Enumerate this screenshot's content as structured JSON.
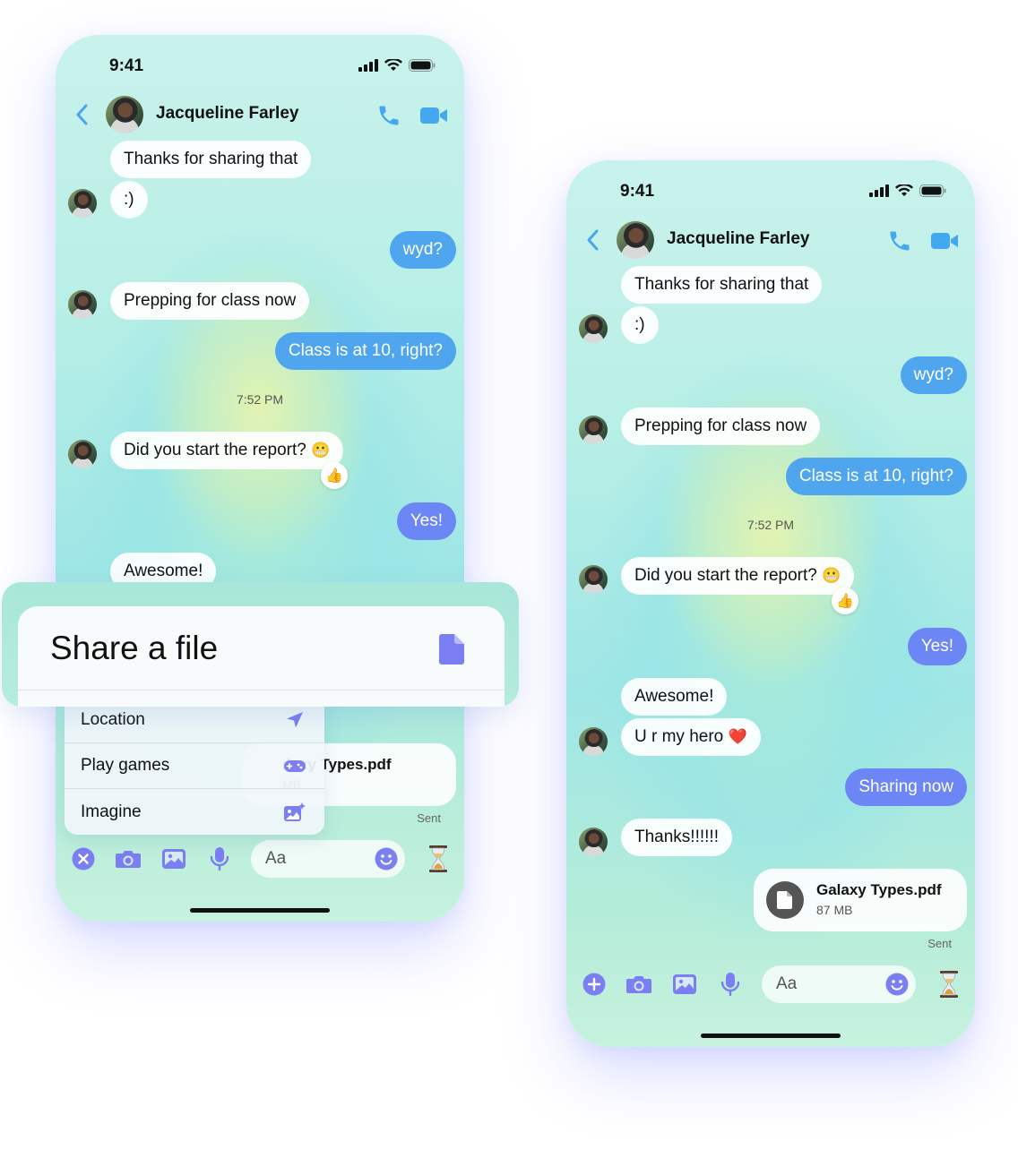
{
  "status": {
    "time": "9:41"
  },
  "contact": {
    "name": "Jacqueline Farley"
  },
  "messages": {
    "m1": "Thanks for sharing that",
    "m2": ":)",
    "m3": "wyd?",
    "m4": "Prepping for class now",
    "m5": "Class is at 10, right?",
    "timestamp": "7:52 PM",
    "m6": "Did you start the report?",
    "m6_emoji": "😬",
    "m6_reaction": "👍",
    "m7": "Yes!",
    "m8": "Awesome!",
    "m9": "U r my hero",
    "m9_emoji": "❤️",
    "m10": "Sharing now",
    "m11": "Thanks!!!!!!"
  },
  "file": {
    "name": "Galaxy Types.pdf",
    "size": "87 MB",
    "partial_name": "ılaxy Types.pdf",
    "partial_size": "MB",
    "status": "Sent"
  },
  "composer": {
    "placeholder": "Aa"
  },
  "share_sheet": {
    "title": "Share a file"
  },
  "attach_menu": {
    "items": [
      "Location",
      "Play games",
      "Imagine"
    ]
  },
  "colors": {
    "incoming_blue": "#4fa6ee",
    "outgoing_indigo": "#6c86f5",
    "icon_purple": "#7b7ff2",
    "icon_blue": "#44a8f0"
  }
}
